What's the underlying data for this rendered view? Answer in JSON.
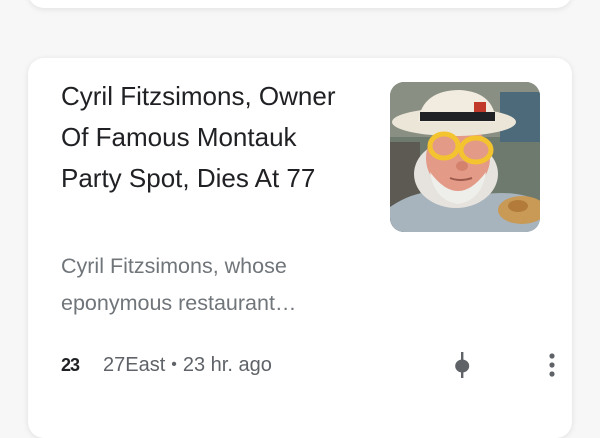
{
  "article": {
    "headline": "Cyril Fitzsimons, Owner Of Famous Montauk Party Spot, Dies At 77",
    "snippet": "Cyril Fitzsimons, whose eponymous restaurant…",
    "source_logo": "23",
    "source_name": "27East",
    "separator": "•",
    "time": "23 hr. ago",
    "thumbnail_icon": "photo-of-man-in-white-hat-and-yellow-glasses"
  },
  "icons": {
    "share": "share-icon",
    "more": "more-vert-icon"
  },
  "colors": {
    "card_bg": "#ffffff",
    "page_bg": "#f7f7f7",
    "headline": "#202124",
    "secondary": "#70757a"
  }
}
